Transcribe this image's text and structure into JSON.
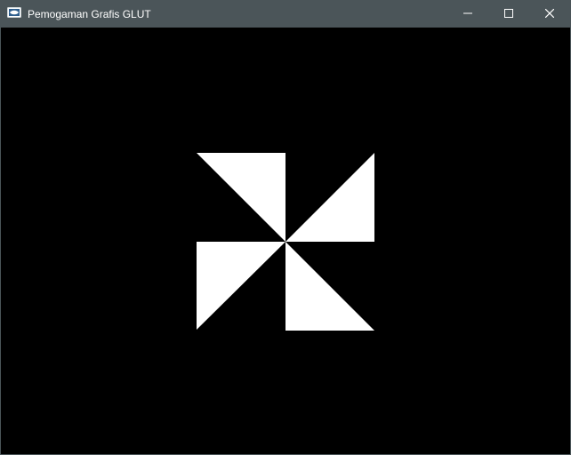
{
  "window": {
    "title": "Pemogaman Grafis GLUT",
    "app_icon": "glut-app-icon",
    "controls": {
      "minimize": "minimize-icon",
      "maximize": "maximize-icon",
      "close": "close-icon"
    }
  },
  "canvas": {
    "background_color": "#000000",
    "shape_color": "#ffffff",
    "shape": "pinwheel"
  },
  "colors": {
    "titlebar": "#4b5559",
    "title_text": "#ffffff"
  }
}
